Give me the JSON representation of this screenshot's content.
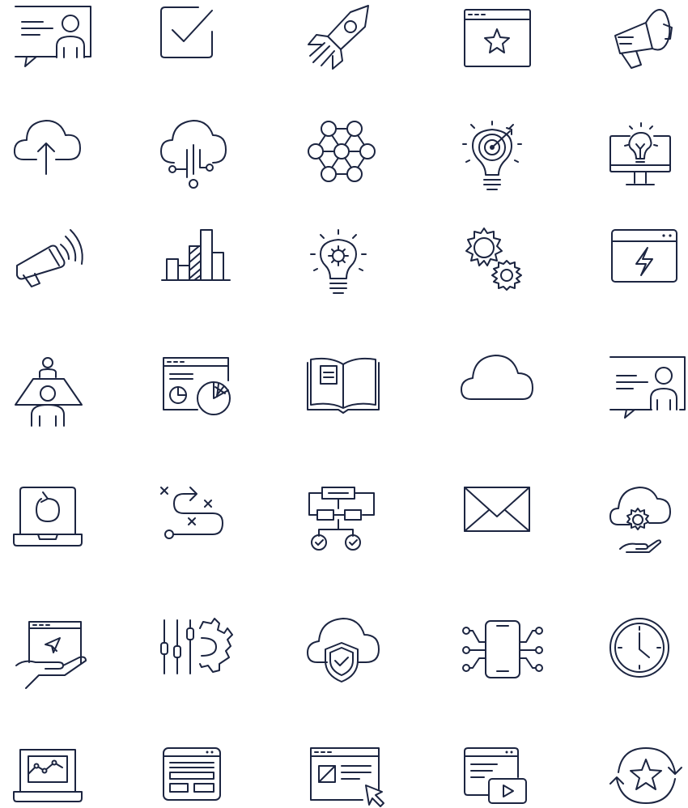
{
  "icon_set": {
    "stroke_color": "#1c2541",
    "background": "#ffffff",
    "rows": [
      [
        "presentation-chat-icon",
        "checkbox-icon",
        "rocket-icon",
        "browser-star-icon",
        "megaphone-icon"
      ],
      [
        "cloud-upload-icon",
        "cloud-network-icon",
        "hexagon-network-icon",
        "idea-target-icon",
        "monitor-idea-icon"
      ],
      [
        "loudspeaker-icon",
        "bar-chart-icon",
        "lightbulb-gear-icon",
        "gears-icon",
        "browser-lightning-icon"
      ],
      [
        "meeting-table-icon",
        "dashboard-pie-chart-icon",
        "open-book-icon",
        "cloud-icon",
        "profile-card-chat-icon"
      ],
      [
        "laptop-refresh-icon",
        "route-path-icon",
        "flowchart-icon",
        "envelope-icon",
        "cloud-gear-hand-icon"
      ],
      [
        "hand-browser-cursor-icon",
        "sliders-gear-icon",
        "cloud-shield-icon",
        "smartphone-circuit-icon",
        "clock-icon"
      ],
      [
        "laptop-line-chart-icon",
        "browser-layout-icon",
        "browser-image-cursor-icon",
        "browser-video-icon",
        "star-refresh-icon"
      ]
    ]
  }
}
